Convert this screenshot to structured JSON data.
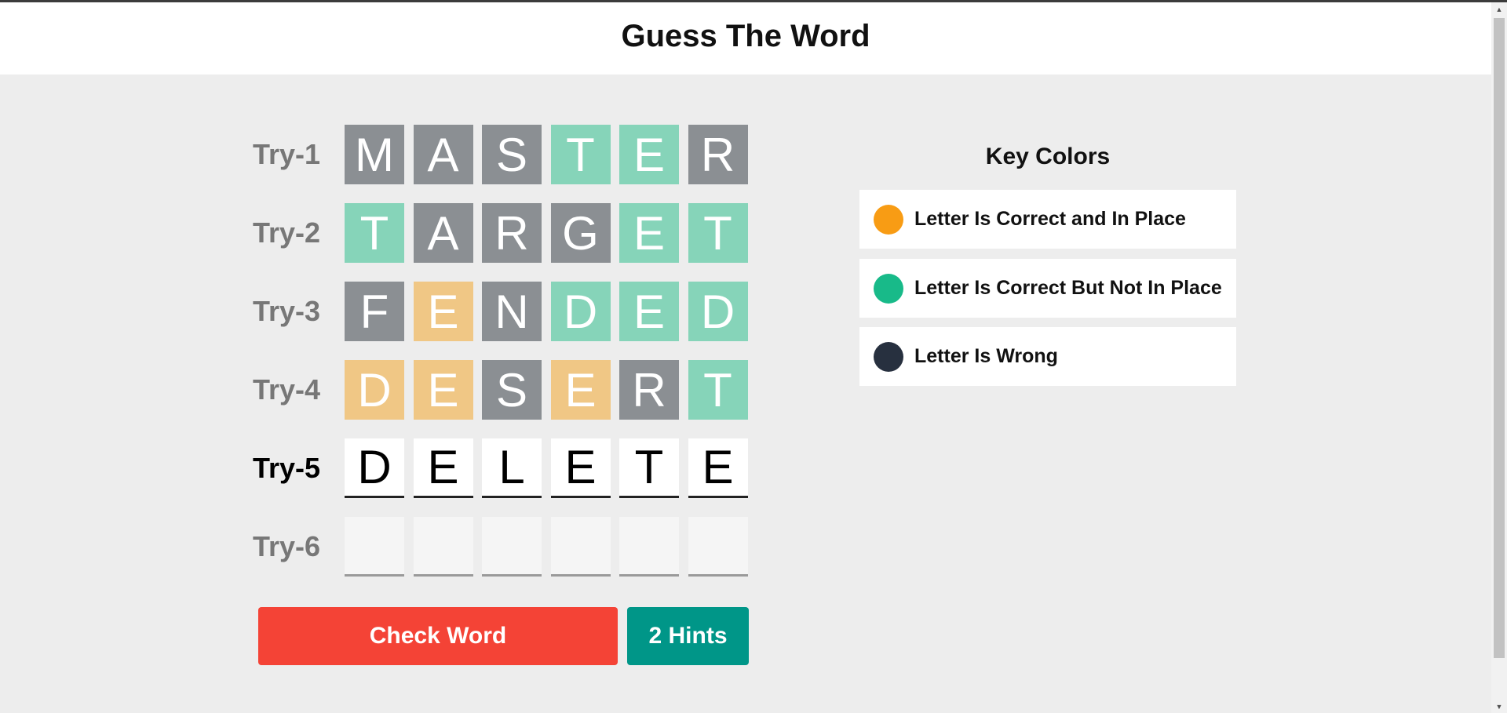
{
  "header": {
    "title": "Guess The Word"
  },
  "board": {
    "rows": [
      {
        "label": "Try-1",
        "state": "done",
        "tiles": [
          {
            "letter": "M",
            "status": "wrong"
          },
          {
            "letter": "A",
            "status": "wrong"
          },
          {
            "letter": "S",
            "status": "wrong"
          },
          {
            "letter": "T",
            "status": "correct-not-in-place"
          },
          {
            "letter": "E",
            "status": "correct-not-in-place"
          },
          {
            "letter": "R",
            "status": "wrong"
          }
        ]
      },
      {
        "label": "Try-2",
        "state": "done",
        "tiles": [
          {
            "letter": "T",
            "status": "correct-not-in-place"
          },
          {
            "letter": "A",
            "status": "wrong"
          },
          {
            "letter": "R",
            "status": "wrong"
          },
          {
            "letter": "G",
            "status": "wrong"
          },
          {
            "letter": "E",
            "status": "correct-not-in-place"
          },
          {
            "letter": "T",
            "status": "correct-not-in-place"
          }
        ]
      },
      {
        "label": "Try-3",
        "state": "done",
        "tiles": [
          {
            "letter": "F",
            "status": "wrong"
          },
          {
            "letter": "E",
            "status": "correct-in-place"
          },
          {
            "letter": "N",
            "status": "wrong"
          },
          {
            "letter": "D",
            "status": "correct-not-in-place"
          },
          {
            "letter": "E",
            "status": "correct-not-in-place"
          },
          {
            "letter": "D",
            "status": "correct-not-in-place"
          }
        ]
      },
      {
        "label": "Try-4",
        "state": "done",
        "tiles": [
          {
            "letter": "D",
            "status": "correct-in-place"
          },
          {
            "letter": "E",
            "status": "correct-in-place"
          },
          {
            "letter": "S",
            "status": "wrong"
          },
          {
            "letter": "E",
            "status": "correct-in-place"
          },
          {
            "letter": "R",
            "status": "wrong"
          },
          {
            "letter": "T",
            "status": "correct-not-in-place"
          }
        ]
      },
      {
        "label": "Try-5",
        "state": "current",
        "tiles": [
          {
            "letter": "D",
            "status": "input"
          },
          {
            "letter": "E",
            "status": "input"
          },
          {
            "letter": "L",
            "status": "input"
          },
          {
            "letter": "E",
            "status": "input"
          },
          {
            "letter": "T",
            "status": "input"
          },
          {
            "letter": "E",
            "status": "input"
          }
        ]
      },
      {
        "label": "Try-6",
        "state": "disabled",
        "tiles": [
          {
            "letter": "",
            "status": "empty"
          },
          {
            "letter": "",
            "status": "empty"
          },
          {
            "letter": "",
            "status": "empty"
          },
          {
            "letter": "",
            "status": "empty"
          },
          {
            "letter": "",
            "status": "empty"
          },
          {
            "letter": "",
            "status": "empty"
          }
        ]
      }
    ]
  },
  "actions": {
    "check_label": "Check Word",
    "hints_label": "2 Hints"
  },
  "key_colors": {
    "title": "Key Colors",
    "items": [
      {
        "label": "Letter Is Correct and In Place",
        "color": "#f89c14"
      },
      {
        "label": "Letter Is Correct But Not In Place",
        "color": "#18ba89"
      },
      {
        "label": "Letter Is Wrong",
        "color": "#27303f"
      }
    ]
  },
  "colors": {
    "tile_wrong": "#8b8f93",
    "tile_correct_not_in_place": "#86d4b9",
    "tile_correct_in_place": "#f0c785",
    "check_button": "#f44336",
    "hints_button": "#009688"
  }
}
